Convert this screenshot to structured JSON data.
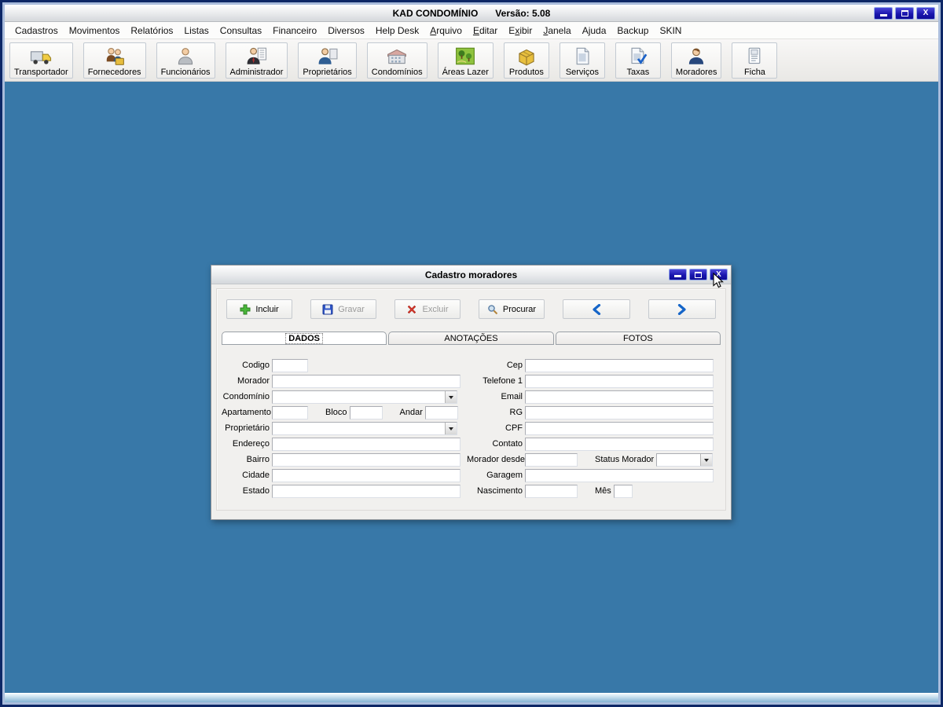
{
  "window": {
    "title": "KAD CONDOMÍNIO",
    "version": "Versão: 5.08",
    "controls": [
      "minimize",
      "maximize",
      "close"
    ]
  },
  "menubar": {
    "items": [
      {
        "label": "Cadastros"
      },
      {
        "label": "Movimentos"
      },
      {
        "label": "Relatórios"
      },
      {
        "label": "Listas"
      },
      {
        "label": "Consultas"
      },
      {
        "label": "Financeiro"
      },
      {
        "label": "Diversos"
      },
      {
        "label": "Help Desk"
      },
      {
        "label": "Arquivo",
        "underline": 0
      },
      {
        "label": "Editar",
        "underline": 0
      },
      {
        "label": "Exibir",
        "underline": 1
      },
      {
        "label": "Janela",
        "underline": 0
      },
      {
        "label": "Ajuda"
      },
      {
        "label": "Backup"
      },
      {
        "label": "SKIN"
      }
    ]
  },
  "toolbar": {
    "buttons": [
      {
        "label": "Transportador",
        "icon": "truck-icon"
      },
      {
        "label": "Fornecedores",
        "icon": "suppliers-icon"
      },
      {
        "label": "Funcionários",
        "icon": "employee-icon"
      },
      {
        "label": "Administrador",
        "icon": "administrator-icon"
      },
      {
        "label": "Proprietários",
        "icon": "owner-icon"
      },
      {
        "label": "Condomínios",
        "icon": "building-icon"
      },
      {
        "label": "Áreas Lazer",
        "icon": "park-icon"
      },
      {
        "label": "Produtos",
        "icon": "product-box-icon"
      },
      {
        "label": "Serviços",
        "icon": "document-icon"
      },
      {
        "label": "Taxas",
        "icon": "document-check-icon"
      },
      {
        "label": "Moradores",
        "icon": "resident-icon"
      },
      {
        "label": "Ficha",
        "icon": "card-icon"
      }
    ]
  },
  "dialog": {
    "title": "Cadastro moradores",
    "controls": [
      "minimize",
      "maximize",
      "close"
    ],
    "action_buttons": [
      {
        "label": "Incluir",
        "icon": "plus-icon",
        "enabled": true
      },
      {
        "label": "Gravar",
        "icon": "save-icon",
        "enabled": false
      },
      {
        "label": "Excluir",
        "icon": "delete-x-icon",
        "enabled": false
      },
      {
        "label": "Procurar",
        "icon": "search-icon",
        "enabled": true
      },
      {
        "label": "",
        "icon": "arrow-left-icon",
        "enabled": true
      },
      {
        "label": "",
        "icon": "arrow-right-icon",
        "enabled": true
      }
    ],
    "tabs": [
      {
        "label": "DADOS",
        "active": true
      },
      {
        "label": "ANOTAÇÕES",
        "active": false
      },
      {
        "label": "FOTOS",
        "active": false
      }
    ],
    "form": {
      "left_rows": [
        {
          "segments": [
            {
              "label": "Codigo",
              "control": {
                "type": "text",
                "size": "sm",
                "value": ""
              }
            }
          ]
        },
        {
          "segments": [
            {
              "label": "Morador",
              "control": {
                "type": "text",
                "size": "lg",
                "value": ""
              }
            }
          ]
        },
        {
          "segments": [
            {
              "label": "Condomínio",
              "control": {
                "type": "select",
                "size": "sel",
                "value": ""
              }
            }
          ]
        },
        {
          "segments": [
            {
              "label": "Apartamento",
              "control": {
                "type": "text",
                "size": "sm",
                "value": ""
              }
            },
            {
              "label": "Bloco",
              "control": {
                "type": "text",
                "size": "sm2",
                "value": ""
              }
            },
            {
              "label": "Andar",
              "control": {
                "type": "text",
                "size": "sm2",
                "value": ""
              }
            }
          ]
        },
        {
          "segments": [
            {
              "label": "Proprietário",
              "control": {
                "type": "select",
                "size": "sel",
                "value": ""
              }
            }
          ]
        },
        {
          "segments": [
            {
              "label": "Endereço",
              "control": {
                "type": "text",
                "size": "lg",
                "value": ""
              }
            }
          ]
        },
        {
          "segments": [
            {
              "label": "Bairro",
              "control": {
                "type": "text",
                "size": "lg",
                "value": ""
              }
            }
          ]
        },
        {
          "segments": [
            {
              "label": "Cidade",
              "control": {
                "type": "text",
                "size": "lg",
                "value": ""
              }
            }
          ]
        },
        {
          "segments": [
            {
              "label": "Estado",
              "control": {
                "type": "text",
                "size": "lg",
                "value": ""
              }
            }
          ]
        }
      ],
      "right_rows": [
        {
          "segments": [
            {
              "label": "Cep",
              "control": {
                "type": "text",
                "size": "lg",
                "value": ""
              }
            }
          ]
        },
        {
          "segments": [
            {
              "label": "Telefone 1",
              "control": {
                "type": "text",
                "size": "lg",
                "value": ""
              }
            }
          ]
        },
        {
          "segments": [
            {
              "label": "Email",
              "control": {
                "type": "text",
                "size": "lg",
                "value": ""
              }
            }
          ]
        },
        {
          "segments": [
            {
              "label": "RG",
              "control": {
                "type": "text",
                "size": "lg",
                "value": ""
              }
            }
          ]
        },
        {
          "segments": [
            {
              "label": "CPF",
              "control": {
                "type": "text",
                "size": "lg",
                "value": ""
              }
            }
          ]
        },
        {
          "segments": [
            {
              "label": "Contato",
              "control": {
                "type": "text",
                "size": "lg",
                "value": ""
              }
            }
          ]
        },
        {
          "segments": [
            {
              "label": "Morador desde",
              "control": {
                "type": "text",
                "size": "md",
                "value": ""
              }
            },
            {
              "label": "Status Morador",
              "control": {
                "type": "select",
                "size": "selsm",
                "value": ""
              }
            }
          ]
        },
        {
          "segments": [
            {
              "label": "Garagem",
              "control": {
                "type": "text",
                "size": "lg",
                "value": ""
              }
            }
          ]
        },
        {
          "segments": [
            {
              "label": "Nascimento",
              "control": {
                "type": "text",
                "size": "md",
                "value": ""
              }
            },
            {
              "label": "Mês",
              "control": {
                "type": "text",
                "size": "xs",
                "value": ""
              }
            }
          ]
        }
      ]
    }
  },
  "colors": {
    "client_background": "#3878a8",
    "frame_navy": "#0d2766",
    "titlebar_button_blue": "#1a16ae",
    "accent_blue": "#1565c8",
    "include_green": "#49b83a",
    "delete_red": "#d23a2e"
  }
}
